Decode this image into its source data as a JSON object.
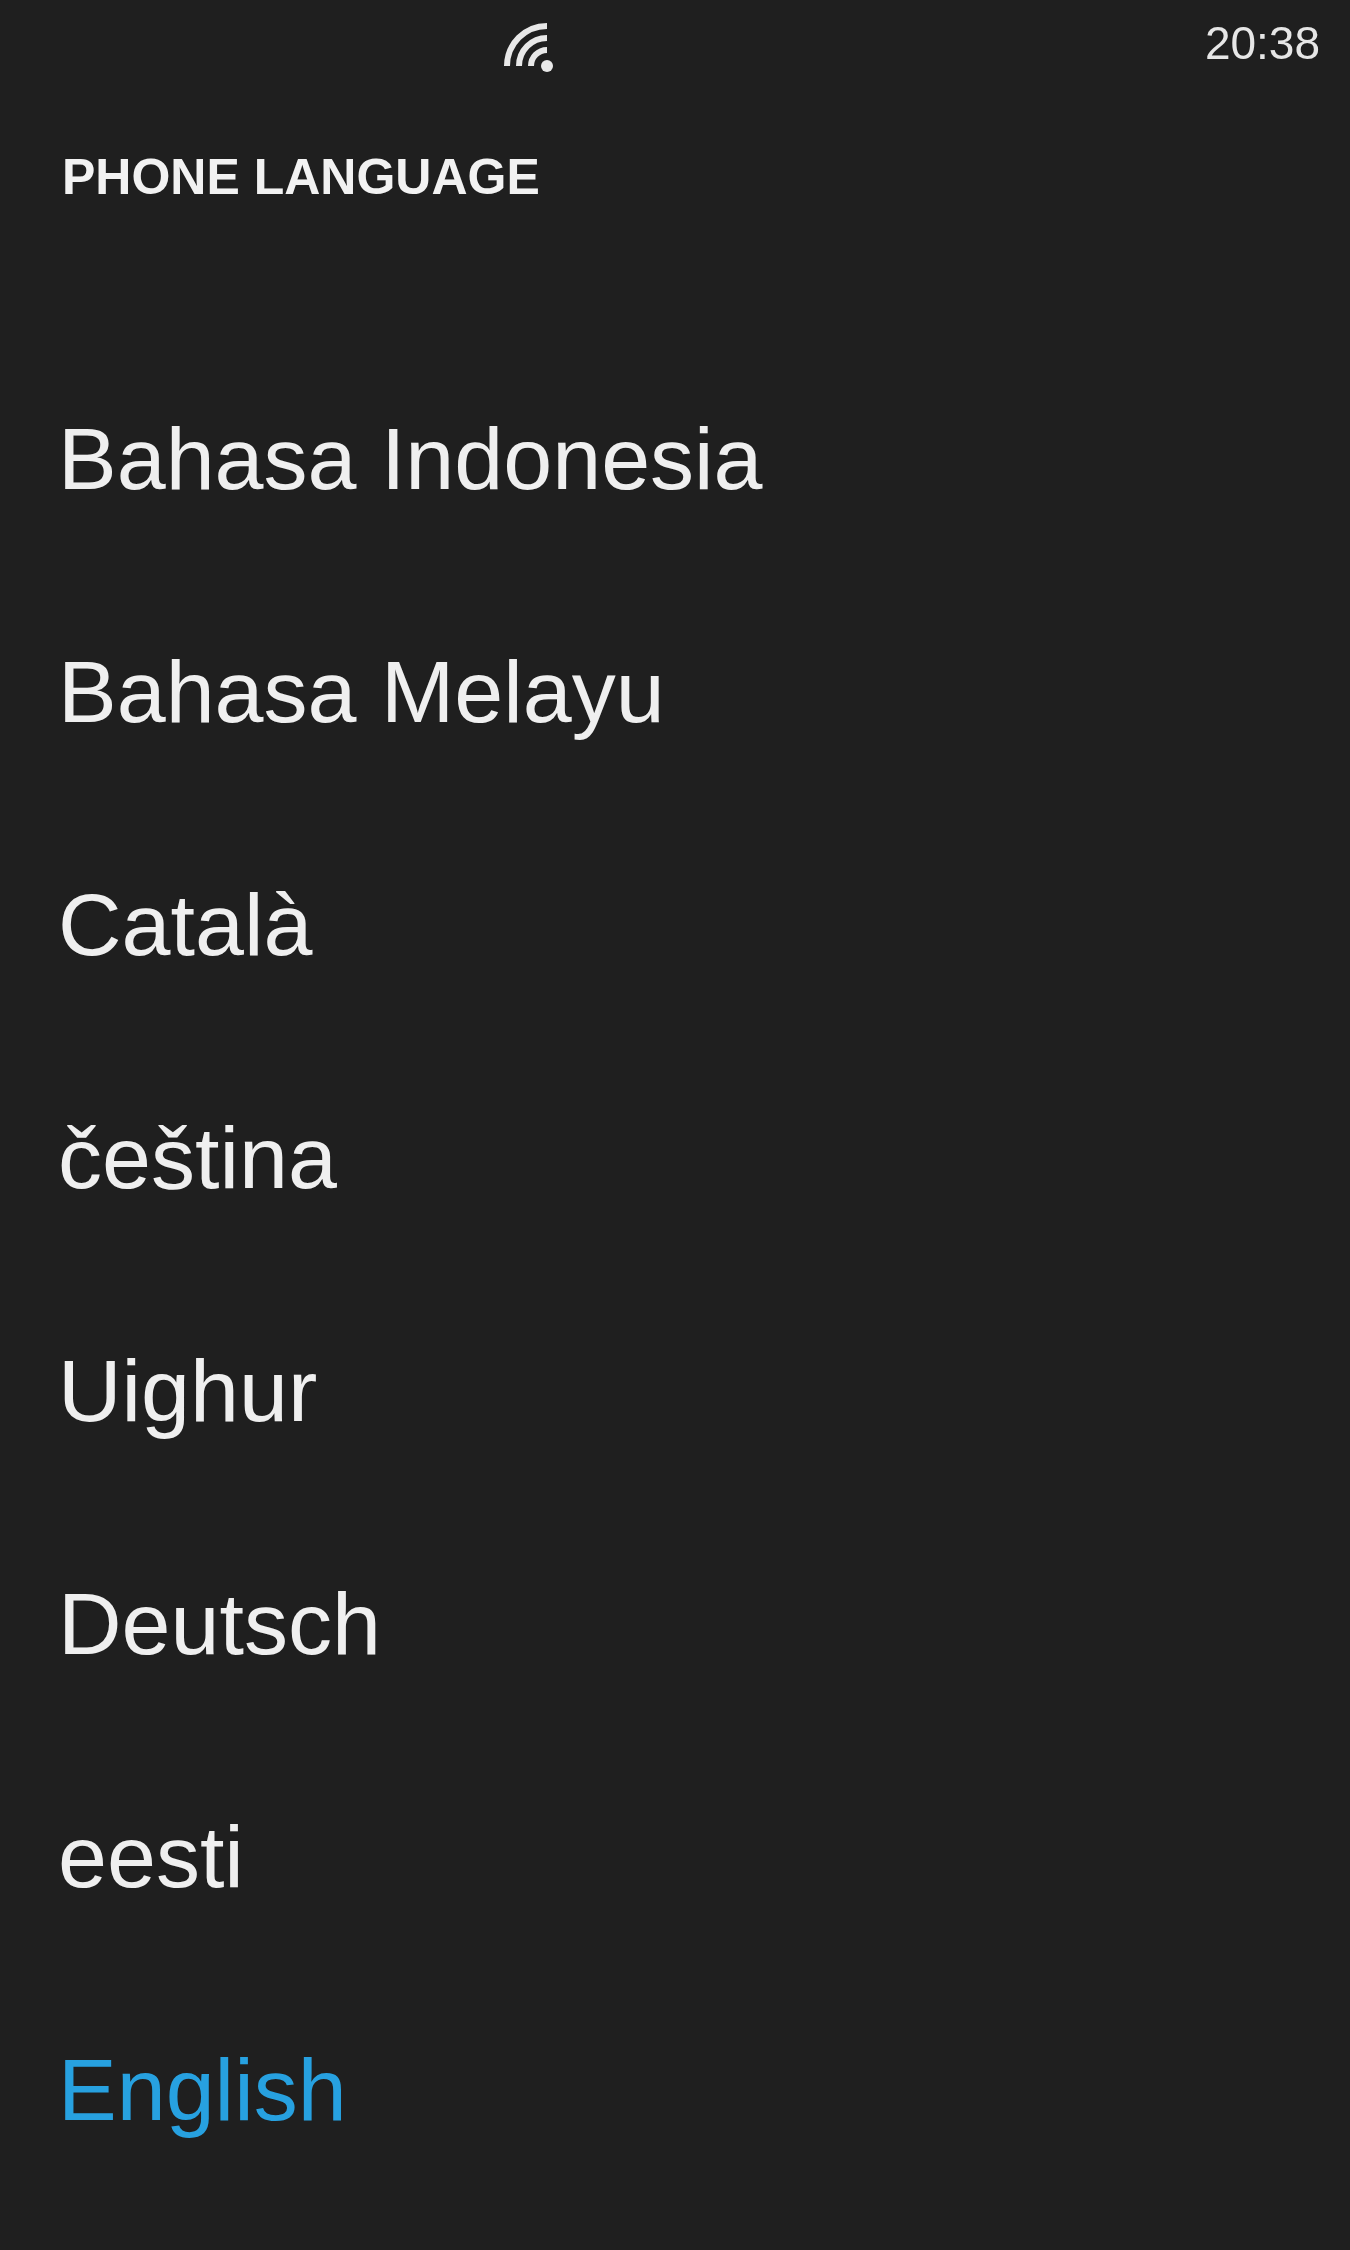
{
  "status_bar": {
    "time": "20:38"
  },
  "title": "PHONE LANGUAGE",
  "languages": [
    {
      "label": "Bahasa Indonesia",
      "selected": false
    },
    {
      "label": "Bahasa Melayu",
      "selected": false
    },
    {
      "label": "Català",
      "selected": false
    },
    {
      "label": "čeština",
      "selected": false
    },
    {
      "label": "Uighur",
      "selected": false
    },
    {
      "label": "Deutsch",
      "selected": false
    },
    {
      "label": "eesti",
      "selected": false
    },
    {
      "label": "English",
      "selected": true
    }
  ]
}
